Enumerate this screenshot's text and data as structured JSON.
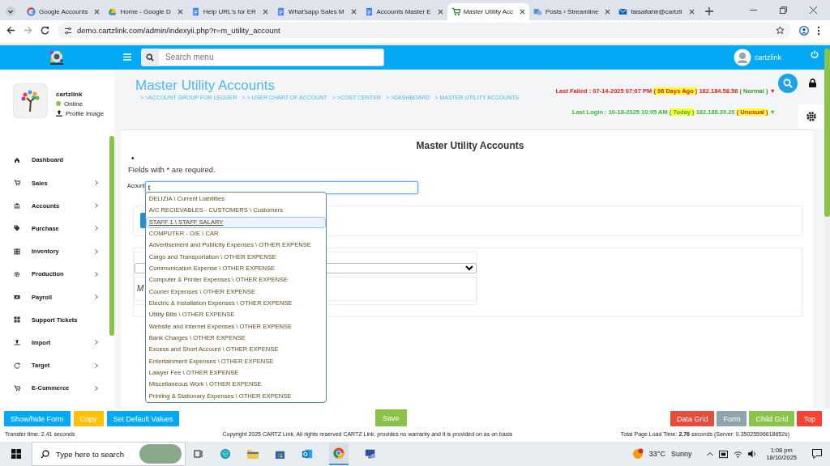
{
  "browser": {
    "tabs": [
      {
        "title": "Google Accounts",
        "kind": "google",
        "selected": false
      },
      {
        "title": "Home - Google D",
        "kind": "drive",
        "selected": false
      },
      {
        "title": "Help URL's for ER",
        "kind": "doc",
        "selected": false
      },
      {
        "title": "What'sapp Sales M",
        "kind": "doc",
        "selected": false
      },
      {
        "title": "Accounts Master E",
        "kind": "doc",
        "selected": false
      },
      {
        "title": "Master Utility Acc",
        "kind": "cart",
        "selected": true
      },
      {
        "title": "Posts ‹ Streamline",
        "kind": "site",
        "selected": false
      },
      {
        "title": "faisaltahir@cartzli",
        "kind": "mail",
        "selected": false
      }
    ],
    "url": "demo.cartzlink.com/admin/indexyii.php?r=m_utility_account"
  },
  "header": {
    "search_placeholder": "Search menu",
    "user": "cartzlink"
  },
  "sidebar": {
    "profile": {
      "name": "cartzlink",
      "status": "Online",
      "link": "Profile Image"
    },
    "items": [
      {
        "label": "Dashboard",
        "kind": "home",
        "expandable": false
      },
      {
        "label": "Sales",
        "kind": "cart",
        "expandable": true
      },
      {
        "label": "Accounts",
        "kind": "bank",
        "expandable": true
      },
      {
        "label": "Purchase",
        "kind": "tag",
        "expandable": true
      },
      {
        "label": "Inventory",
        "kind": "grid",
        "expandable": true
      },
      {
        "label": "Production",
        "kind": "cog",
        "expandable": true
      },
      {
        "label": "Payroll",
        "kind": "money",
        "expandable": true
      },
      {
        "label": "Support Tickets",
        "kind": "tiles",
        "expandable": false
      },
      {
        "label": "Import",
        "kind": "upload",
        "expandable": true
      },
      {
        "label": "Target",
        "kind": "refresh",
        "expandable": true
      },
      {
        "label": "E-Commerce",
        "kind": "cart",
        "expandable": true
      }
    ]
  },
  "page": {
    "title": "Master Utility Accounts",
    "breadcrumbs": [
      "> >ACCOUNT GROUP FOR LEDGER",
      "> > USER CHART OF ACCOUNT",
      "> >COST CENTER",
      "> >DASHBOARD",
      "> MASTER UTILITY ACCOUNTS"
    ],
    "last_failed": [
      {
        "text": "Last Failed : 07-14-2025 07:07 PM",
        "kind": "danger",
        "highlight": false
      },
      {
        "text": "( 96 Days Ago )",
        "kind": "danger",
        "highlight": true
      },
      {
        "text": "182.184.58.56",
        "kind": "danger",
        "highlight": false
      },
      {
        "text": "( Normal )",
        "kind": "ok",
        "highlight": false
      },
      {
        "text": "▼",
        "kind": "danger",
        "highlight": false
      }
    ],
    "last_login": [
      {
        "text": "Last Login : 10-18-2025 10:05 AM",
        "kind": "success",
        "highlight": false
      },
      {
        "text": "( Today )",
        "kind": "success",
        "highlight": true
      },
      {
        "text": "182.188.39.20",
        "kind": "success",
        "highlight": false
      },
      {
        "text": "( Unusual )",
        "kind": "danger",
        "highlight": true
      },
      {
        "text": "▼",
        "kind": "success",
        "highlight": false
      }
    ]
  },
  "form": {
    "heading": "Master Utility Accounts",
    "bullet": "•",
    "note": "Fields with * are required.",
    "account_label": "Acount",
    "account_value": "t",
    "suggestions": [
      {
        "label": "DELIZIA \\ Current Liabilities",
        "selected": false
      },
      {
        "label": "A/C RECIEVABLES - CUSTOMERS \\ Customers",
        "selected": false
      },
      {
        "label": "STAFF 1 \\ STAFF SALARY",
        "selected": true
      },
      {
        "label": "COMPUTER - O/E \\ CAR",
        "selected": false
      },
      {
        "label": "Advertisement and Publicity Expenses \\ OTHER EXPENSE",
        "selected": false
      },
      {
        "label": "Cargo and Transportation \\ OTHER EXPENSE",
        "selected": false
      },
      {
        "label": "Communication Expense \\ OTHER EXPENSE",
        "selected": false
      },
      {
        "label": "Computer & Printer Expenses \\ OTHER EXPENSE",
        "selected": false
      },
      {
        "label": "Courier Expenses \\ OTHER EXPENSE",
        "selected": false
      },
      {
        "label": "Electric & Installation Expenses \\ OTHER EXPENSE",
        "selected": false
      },
      {
        "label": "Utility Bills \\ OTHER EXPENSE",
        "selected": false
      },
      {
        "label": "Website and Internet Expenses \\ OTHER EXPENSE",
        "selected": false
      },
      {
        "label": "Bank Charges \\ OTHER EXPENSE",
        "selected": false
      },
      {
        "label": "Excess and Short Account \\ OTHER EXPENSE",
        "selected": false
      },
      {
        "label": "Entertainment Expenses \\ OTHER EXPENSE",
        "selected": false
      },
      {
        "label": "Lawyer Fee \\ OTHER EXPENSE",
        "selected": false
      },
      {
        "label": "Miscellaneous Work \\ OTHER EXPENSE",
        "selected": false
      },
      {
        "label": "Printing & Stationary Expenses \\ OTHER EXPENSE",
        "selected": false
      }
    ],
    "covered_text": "M"
  },
  "toolbar": {
    "left": [
      {
        "label": "Show/hide Form",
        "color": "#03a9f4"
      },
      {
        "label": "Copy",
        "color": "#ffc107"
      },
      {
        "label": "Set Default Values",
        "color": "#03a9f4"
      }
    ],
    "center": [
      {
        "label": "Save",
        "color": "#8bc34a"
      }
    ],
    "right": [
      {
        "label": "Data Grid",
        "color": "#e74c3c"
      },
      {
        "label": "Form",
        "color": "#90a4ae"
      },
      {
        "label": "Child Grid",
        "color": "#8bc34a"
      },
      {
        "label": "Top",
        "color": "#f44336"
      }
    ]
  },
  "status_bar": {
    "transfer": "Transfer time: 2.41 seconds",
    "copyright": "Copyright 2025 CARTZ Link. All rights reserved CARTZ Link. provides no warranty and it is provided on as on basis",
    "load_time": "Total Page Load Time: **2.76** seconds (Server: 0.35025596618652s)"
  },
  "taskbar": {
    "search_placeholder": "Type here to search",
    "temperature": "33°C",
    "weather": "Sunny",
    "time": "1:08 pm",
    "date": "18/10/2025"
  }
}
